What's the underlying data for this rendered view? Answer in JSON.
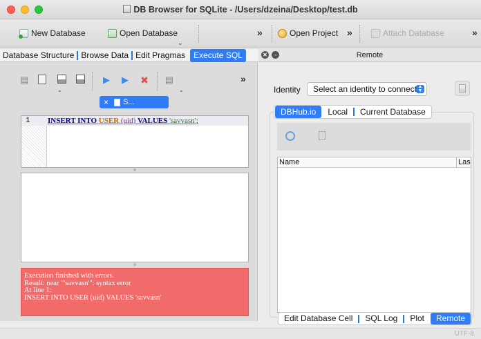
{
  "window": {
    "title": "DB Browser for SQLite - /Users/dzeina/Desktop/test.db"
  },
  "toolbar": {
    "new_database": "New Database",
    "open_database": "Open Database",
    "open_project": "Open Project",
    "attach_database": "Attach Database",
    "more_symbol": "»"
  },
  "left_tabs": [
    {
      "label": "Database Structure"
    },
    {
      "label": "Browse Data"
    },
    {
      "label": "Edit Pragmas"
    },
    {
      "label": "Execute SQL",
      "active": true
    }
  ],
  "sql_tab": {
    "close": "×",
    "label": "S..."
  },
  "editor": {
    "line_number": "1",
    "tokens": {
      "kw_insert_into": "INSERT INTO",
      "table": "USER",
      "column": "(uid)",
      "kw_values": "VALUES",
      "string": "'savvasn'",
      "end": ";"
    }
  },
  "error": {
    "lines": [
      "Execution finished with errors.",
      "Result: near \"'savvasn'\": syntax error",
      "At line 1:",
      "INSERT INTO USER (uid) VALUES 'savvasn'"
    ]
  },
  "remote": {
    "header_title": "Remote",
    "identity_label": "Identity",
    "identity_select": "Select an identity to connect",
    "tabs": [
      "DBHub.io",
      "Local",
      "Current Database"
    ],
    "active_tab": "DBHub.io",
    "table_columns": [
      "Name",
      "Last modified"
    ]
  },
  "bottom_tabs": [
    {
      "label": "Edit Database Cell"
    },
    {
      "label": "SQL Log"
    },
    {
      "label": "Plot"
    },
    {
      "label": "Remote",
      "active": true
    }
  ],
  "statusbar": {
    "encoding": "UTF-8"
  },
  "colors": {
    "accent": "#2f7cf6",
    "error_bg": "#f26b6b"
  }
}
